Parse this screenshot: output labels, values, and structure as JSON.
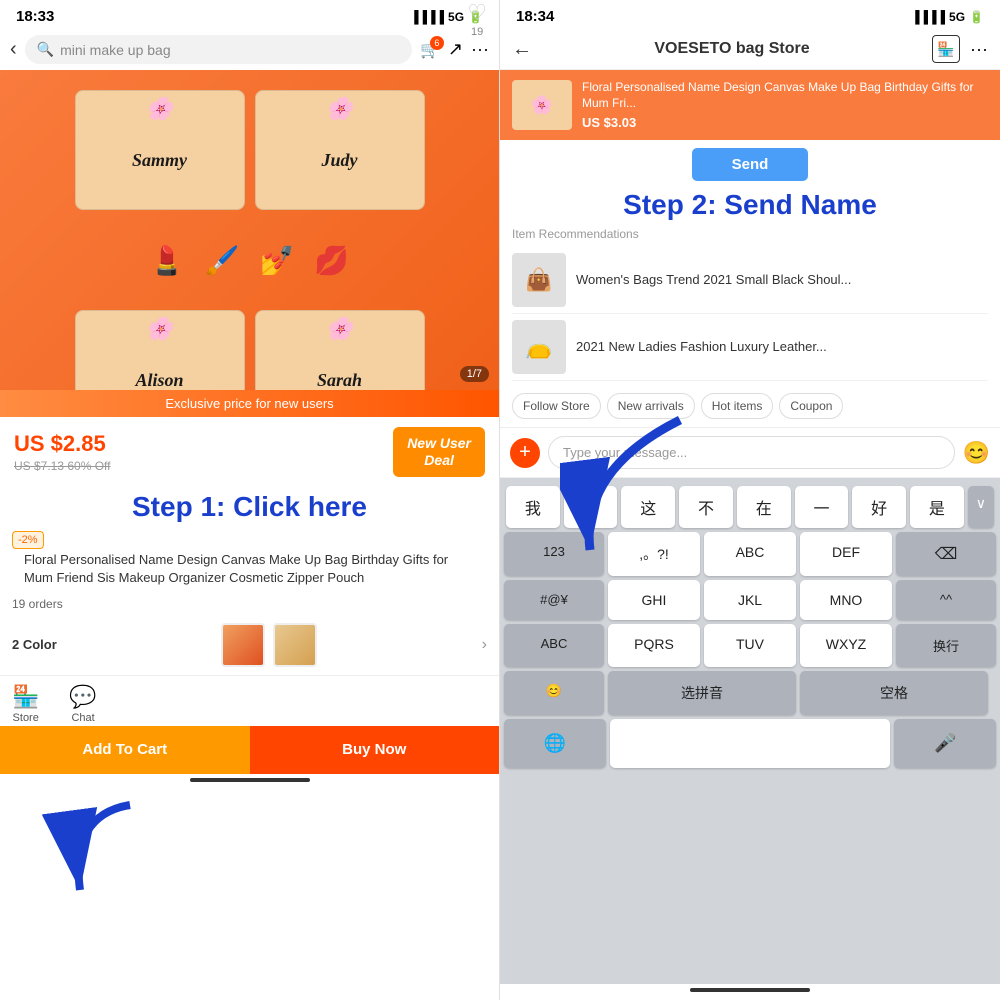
{
  "left": {
    "status_time": "18:33",
    "status_signal": "5G",
    "search_placeholder": "mini make up bag",
    "product_image_counter": "1/7",
    "exclusive_banner": "Exclusive price for new users",
    "price_main": "US $2.85",
    "price_old": "US $7.13 60% Off",
    "new_user_deal": "New User\nDeal",
    "step1_label": "Step 1: Click here",
    "discount_badge": "-2%",
    "product_title": "Floral Personalised Name Design Canvas Make Up Bag Birthday Gifts for Mum Friend Sis Makeup Organizer Cosmetic Zipper Pouch",
    "orders": "19 orders",
    "color_label": "2 Color",
    "add_to_cart": "Add To Cart",
    "buy_now": "Buy Now",
    "store_label": "Store",
    "chat_label": "Chat",
    "bag_names": [
      "Sammy",
      "Judy",
      "Alison",
      "Sarah"
    ]
  },
  "right": {
    "status_time": "18:34",
    "status_signal": "5G",
    "store_title": "VOESETO bag Store",
    "product_preview_title": "Floral Personalised Name Design Canvas Make Up Bag Birthday Gifts for Mum Fri...",
    "product_preview_price": "US $3.03",
    "send_button": "Send",
    "step2_label": "Step 2: Send Name",
    "item_recommendations": "Item Recommendations",
    "rec_items": [
      {
        "title": "Women's Bags Trend 2021 Small Black Shoul...",
        "icon": "👜"
      },
      {
        "title": "2021 New Ladies Fashion Luxury Leather...",
        "icon": "👝"
      }
    ],
    "tabs": [
      "Follow Store",
      "New arrivals",
      "Hot items",
      "Coupon"
    ],
    "message_placeholder": "Type your message...",
    "kb_quick": [
      "我",
      "你",
      "这",
      "不",
      "在",
      "一",
      "好",
      "是"
    ],
    "kb_row1": [
      "123",
      ",。?!",
      "ABC",
      "DEF"
    ],
    "kb_row2": [
      "#@¥",
      "GHI",
      "JKL",
      "MNO"
    ],
    "kb_row3": [
      "ABC",
      "PQRS",
      "TUV",
      "WXYZ"
    ],
    "kb_row4_emoji": "😊",
    "kb_row4_pinyin": "选拼音",
    "kb_row4_space": "空格",
    "kb_row4_huanhang": "换行",
    "kb_bottom_globe": "🌐",
    "kb_bottom_mic": "🎤"
  }
}
